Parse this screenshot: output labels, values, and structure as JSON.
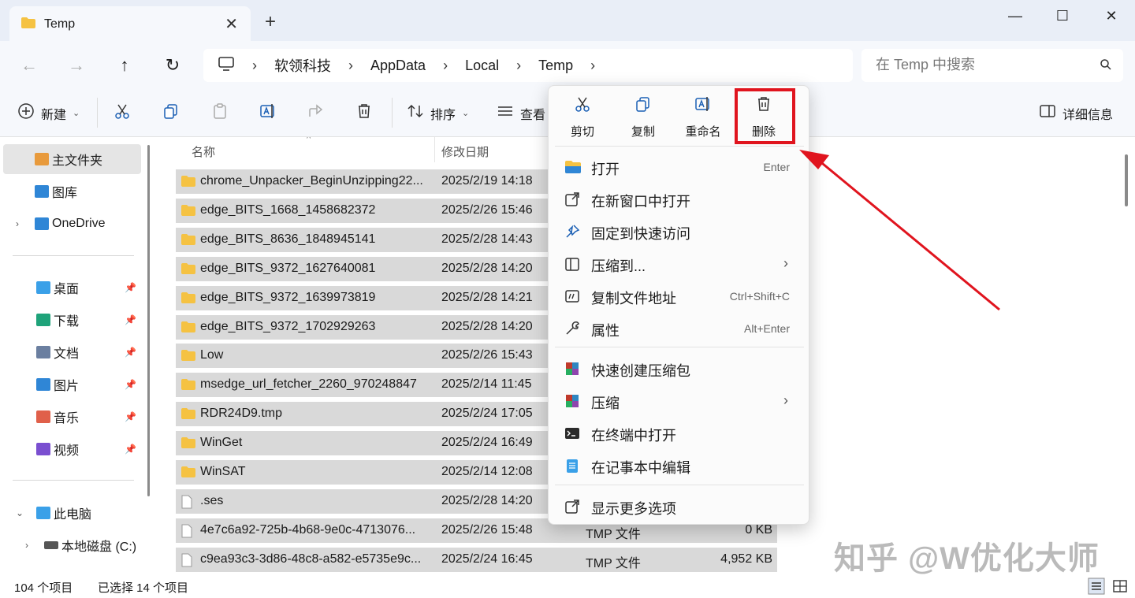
{
  "window": {
    "tab_title": "Temp",
    "new_tab": "+",
    "minimize": "—",
    "maximize": "☐",
    "close": "✕"
  },
  "address": {
    "crumbs": [
      "软领科技",
      "AppData",
      "Local",
      "Temp"
    ],
    "search_placeholder": "在 Temp 中搜索"
  },
  "toolbar": {
    "new_label": "新建",
    "sort_label": "排序",
    "view_label": "查看",
    "details_label": "详细信息"
  },
  "sidebar": {
    "items": [
      {
        "label": "主文件夹",
        "color": "#e89a3c"
      },
      {
        "label": "图库",
        "color": "#2f86d6"
      },
      {
        "label": "OneDrive",
        "color": "#2f86d6"
      },
      {
        "label": "桌面",
        "color": "#3aa0e8"
      },
      {
        "label": "下载",
        "color": "#1fa37a"
      },
      {
        "label": "文档",
        "color": "#6b7fa0"
      },
      {
        "label": "图片",
        "color": "#2f86d6"
      },
      {
        "label": "音乐",
        "color": "#e0604a"
      },
      {
        "label": "视频",
        "color": "#7a4fd0"
      },
      {
        "label": "此电脑",
        "color": "#3aa0e8"
      },
      {
        "label": "本地磁盘 (C:)",
        "color": "#555555"
      }
    ]
  },
  "filelist": {
    "col_name": "名称",
    "col_date": "修改日期",
    "rows": [
      {
        "name": "chrome_Unpacker_BeginUnzipping22...",
        "date": "2025/2/19 14:18",
        "type": "",
        "size": "",
        "kind": "folder"
      },
      {
        "name": "edge_BITS_1668_1458682372",
        "date": "2025/2/26 15:46",
        "type": "",
        "size": "",
        "kind": "folder"
      },
      {
        "name": "edge_BITS_8636_1848945141",
        "date": "2025/2/28 14:43",
        "type": "",
        "size": "",
        "kind": "folder"
      },
      {
        "name": "edge_BITS_9372_1627640081",
        "date": "2025/2/28 14:20",
        "type": "",
        "size": "",
        "kind": "folder"
      },
      {
        "name": "edge_BITS_9372_1639973819",
        "date": "2025/2/28 14:21",
        "type": "",
        "size": "",
        "kind": "folder"
      },
      {
        "name": "edge_BITS_9372_1702929263",
        "date": "2025/2/28 14:20",
        "type": "",
        "size": "",
        "kind": "folder"
      },
      {
        "name": "Low",
        "date": "2025/2/26 15:43",
        "type": "",
        "size": "",
        "kind": "folder"
      },
      {
        "name": "msedge_url_fetcher_2260_970248847",
        "date": "2025/2/14 11:45",
        "type": "",
        "size": "",
        "kind": "folder"
      },
      {
        "name": "RDR24D9.tmp",
        "date": "2025/2/24 17:05",
        "type": "",
        "size": "",
        "kind": "folder"
      },
      {
        "name": "WinGet",
        "date": "2025/2/24 16:49",
        "type": "",
        "size": "",
        "kind": "folder"
      },
      {
        "name": "WinSAT",
        "date": "2025/2/14 12:08",
        "type": "",
        "size": "",
        "kind": "folder"
      },
      {
        "name": ".ses",
        "date": "2025/2/28 14:20",
        "type": "",
        "size": "",
        "kind": "file"
      },
      {
        "name": "4e7c6a92-725b-4b68-9e0c-4713076...",
        "date": "2025/2/26 15:48",
        "type": "TMP 文件",
        "size": "0 KB",
        "kind": "file"
      },
      {
        "name": "c9ea93c3-3d86-48c8-a582-e5735e9c...",
        "date": "2025/2/24 16:45",
        "type": "TMP 文件",
        "size": "4,952 KB",
        "kind": "file"
      }
    ]
  },
  "status": {
    "count": "104 个项目",
    "selected": "已选择 14 个项目"
  },
  "context_menu": {
    "quick_actions": [
      "剪切",
      "复制",
      "重命名",
      "删除"
    ],
    "items": [
      {
        "label": "打开",
        "shortcut": "Enter"
      },
      {
        "label": "在新窗口中打开",
        "shortcut": ""
      },
      {
        "label": "固定到快速访问",
        "shortcut": ""
      },
      {
        "label": "压缩到...",
        "shortcut": ""
      },
      {
        "label": "复制文件地址",
        "shortcut": "Ctrl+Shift+C"
      },
      {
        "label": "属性",
        "shortcut": "Alt+Enter"
      },
      {
        "label": "快速创建压缩包",
        "shortcut": ""
      },
      {
        "label": "压缩",
        "shortcut": ""
      },
      {
        "label": "在终端中打开",
        "shortcut": ""
      },
      {
        "label": "在记事本中编辑",
        "shortcut": ""
      },
      {
        "label": "显示更多选项",
        "shortcut": ""
      }
    ],
    "arrow": "›"
  },
  "annotation": {
    "highlight_color": "#e0141e"
  },
  "watermark": "知乎 @W优化大师",
  "colors": {
    "folder": "#f5c242",
    "accent": "#e0141e"
  }
}
